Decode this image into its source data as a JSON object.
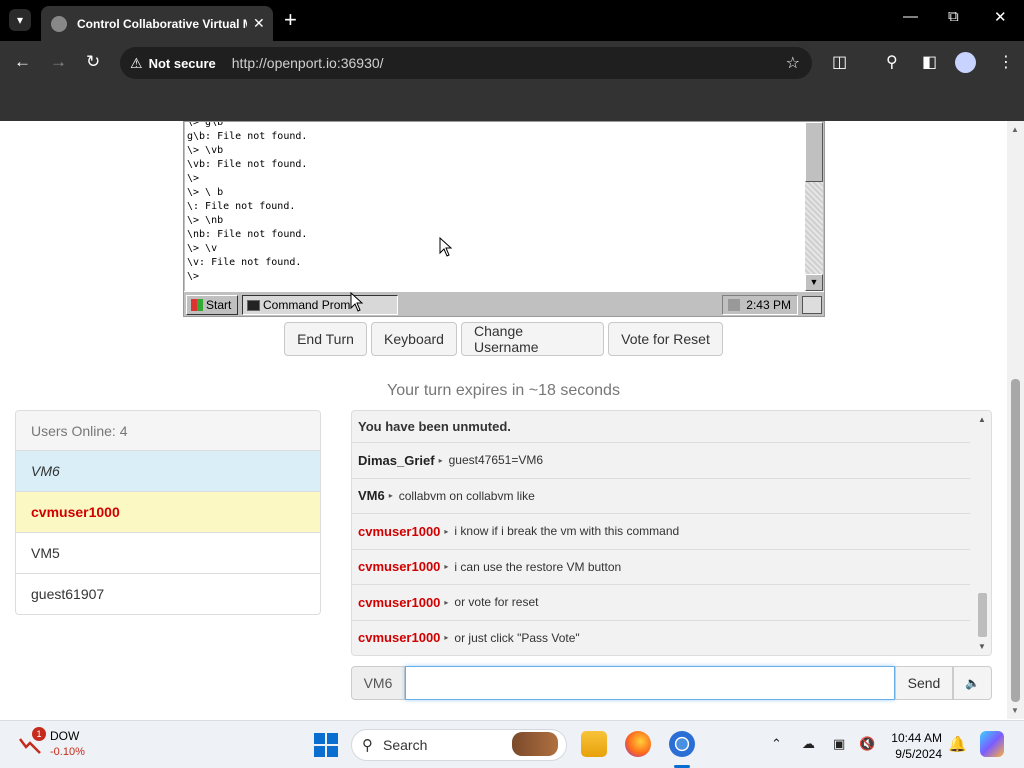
{
  "browser": {
    "tab_title": "Control Collaborative Virtual M",
    "not_secure": "Not secure",
    "url": "http://openport.io:36930/",
    "icons": [
      "tab-menu-icon",
      "close-icon",
      "plus-icon",
      "minimize-icon",
      "restore-icon",
      "back-icon",
      "forward-icon",
      "reload-icon",
      "warning-icon",
      "star-icon",
      "extensions-icon",
      "labs-icon",
      "sidebar-icon",
      "profile-icon",
      "menu-icon"
    ]
  },
  "vm": {
    "console_lines": [
      "\\> g\\b",
      "g\\b: File not found.",
      "\\> \\vb",
      "\\vb: File not found.",
      "\\>",
      "\\> \\ b",
      "\\: File not found.",
      "\\> \\nb",
      "\\nb: File not found.",
      "\\> \\v",
      "\\v: File not found.",
      "\\>"
    ],
    "start_label": "Start",
    "task_label": "Command Prom",
    "time": "2:43 PM"
  },
  "controls": {
    "end_turn": "End Turn",
    "keyboard": "Keyboard",
    "change_username": "Change Username",
    "vote_reset": "Vote for Reset"
  },
  "turn_status": "Your turn expires in ~18 seconds",
  "users": {
    "header": "Users Online: 4",
    "list": [
      {
        "name": "VM6",
        "state": "turn"
      },
      {
        "name": "cvmuser1000",
        "state": "waiting"
      },
      {
        "name": "VM5",
        "state": "normal"
      },
      {
        "name": "guest61907",
        "state": "normal"
      }
    ]
  },
  "chat": {
    "system_message": "You have been unmuted.",
    "messages": [
      {
        "user": "Dimas_Grief",
        "text": "guest47651=VM6",
        "color": "#222222"
      },
      {
        "user": "VM6",
        "text": "collabvm on collabvm like",
        "color": "#222222"
      },
      {
        "user": "cvmuser1000",
        "text": "i know if i break the vm with this command",
        "color": "#d10000"
      },
      {
        "user": "cvmuser1000",
        "text": "i can use the restore VM button",
        "color": "#d10000"
      },
      {
        "user": "cvmuser1000",
        "text": "or vote for reset",
        "color": "#d10000"
      },
      {
        "user": "cvmuser1000",
        "text": "or just click \"Pass Vote\"",
        "color": "#d10000"
      }
    ],
    "input_prefix": "VM6",
    "input_value": "",
    "send_label": "Send"
  },
  "taskbar": {
    "stock_name": "DOW",
    "stock_change": "-0.10%",
    "stock_badge": "1",
    "search_label": "Search",
    "time": "10:44 AM",
    "date": "9/5/2024"
  },
  "colors": {
    "chrome_bg": "#333333",
    "active_user_bg": "#d9eef7",
    "waiting_user_bg": "#fcf8c4",
    "waiting_user_text": "#d10000",
    "accent": "#0a6ed1"
  }
}
